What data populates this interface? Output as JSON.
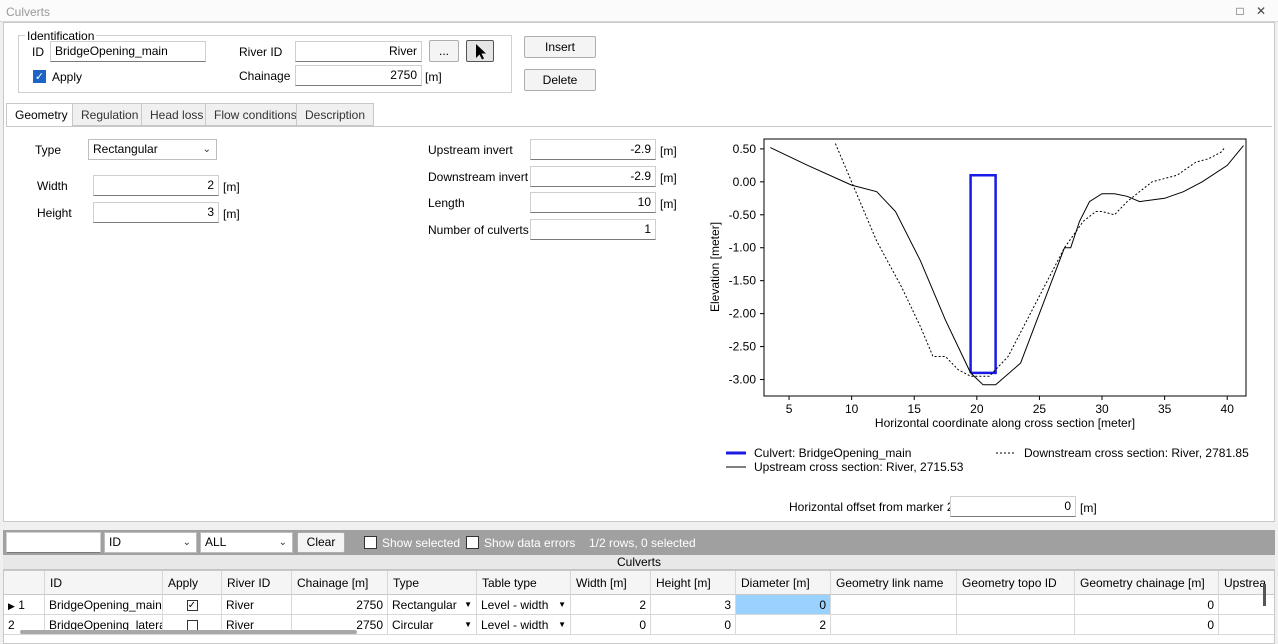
{
  "window": {
    "title": "Culverts"
  },
  "identification": {
    "legend": "Identification",
    "id_label": "ID",
    "id_value": "BridgeOpening_main",
    "apply_label": "Apply",
    "river_id_label": "River ID",
    "river_id_value": "River",
    "browse_label": "...",
    "chainage_label": "Chainage",
    "chainage_value": "2750",
    "unit_m": "[m]"
  },
  "actions": {
    "insert": "Insert",
    "delete": "Delete"
  },
  "tabs": [
    "Geometry",
    "Regulation",
    "Head loss",
    "Flow conditions",
    "Description"
  ],
  "geometry": {
    "type_label": "Type",
    "type_value": "Rectangular",
    "width_label": "Width",
    "width_value": "2",
    "height_label": "Height",
    "height_value": "3",
    "up_invert_label": "Upstream invert",
    "up_invert_value": "-2.9",
    "down_invert_label": "Downstream invert",
    "down_invert_value": "-2.9",
    "length_label": "Length",
    "length_value": "10",
    "num_label": "Number of culverts",
    "num_value": "1",
    "offset_label": "Horizontal offset from marker 2",
    "offset_value": "0",
    "unit": "[m]"
  },
  "chart_data": {
    "type": "line",
    "xlabel": "Horizontal coordinate along cross section [meter]",
    "ylabel": "Elevation [meter]",
    "xlim": [
      3,
      41.5
    ],
    "ylim": [
      -3.25,
      0.65
    ],
    "xticks": [
      5,
      10,
      15,
      20,
      25,
      30,
      35,
      40
    ],
    "yticks": [
      0.5,
      0.0,
      -0.5,
      -1.0,
      -1.5,
      -2.0,
      -2.5,
      -3.0
    ],
    "ytick_labels": [
      "0.50",
      "0.00",
      "-0.50",
      "-1.00",
      "-1.50",
      "-2.00",
      "-2.50",
      "-3.00"
    ],
    "legend": [
      {
        "name": "Culvert: BridgeOpening_main",
        "color": "#1a1ae6",
        "style": "solid-thick"
      },
      {
        "name": "Downstream cross section: River, 2781.85",
        "color": "#000000",
        "style": "dashed"
      },
      {
        "name": "Upstream cross section: River, 2715.53",
        "color": "#000000",
        "style": "solid"
      }
    ],
    "series": [
      {
        "name": "Culvert: BridgeOpening_main",
        "color": "#1a1ae6",
        "x": [
          19.5,
          21.5,
          21.5,
          19.5,
          19.5
        ],
        "y": [
          -2.9,
          -2.9,
          0.1,
          0.1,
          -2.9
        ]
      },
      {
        "name": "Upstream cross section: River, 2715.53",
        "color": "#000000",
        "dash": false,
        "x": [
          3.5,
          6.5,
          10,
          12,
          13.5,
          15.5,
          17.5,
          19.5,
          20.5,
          21.5,
          23.5,
          25,
          26,
          27,
          27.5,
          28.2,
          29,
          30,
          31,
          32,
          33,
          35,
          36.5,
          38,
          40,
          41.3
        ],
        "y": [
          0.52,
          0.25,
          -0.05,
          -0.15,
          -0.45,
          -1.2,
          -2.1,
          -2.9,
          -3.08,
          -3.08,
          -2.75,
          -2.0,
          -1.5,
          -1.0,
          -1.0,
          -0.6,
          -0.3,
          -0.18,
          -0.18,
          -0.22,
          -0.3,
          -0.25,
          -0.15,
          0.0,
          0.25,
          0.55
        ]
      },
      {
        "name": "Downstream cross section: River, 2781.85",
        "color": "#000000",
        "dash": true,
        "x": [
          8.7,
          10,
          12,
          14,
          15.5,
          16.5,
          17.5,
          18.5,
          19.5,
          21,
          22.5,
          24,
          25.5,
          27,
          28.5,
          29.5,
          30,
          31,
          32,
          34,
          36,
          37.5,
          38.5,
          39.5,
          39.8
        ],
        "y": [
          0.58,
          0.0,
          -0.9,
          -1.6,
          -2.2,
          -2.65,
          -2.65,
          -2.85,
          -2.95,
          -2.95,
          -2.65,
          -2.1,
          -1.55,
          -1.0,
          -0.6,
          -0.45,
          -0.45,
          -0.5,
          -0.3,
          0.0,
          0.1,
          0.3,
          0.35,
          0.45,
          0.52
        ]
      }
    ]
  },
  "filter": {
    "text_value": "",
    "column_value": "ID",
    "scope_value": "ALL",
    "clear_label": "Clear",
    "show_selected_label": "Show selected",
    "show_errors_label": "Show data errors",
    "status": "1/2 rows, 0 selected"
  },
  "grid": {
    "title": "Culverts",
    "columns": [
      "ID",
      "Apply",
      "River ID",
      "Chainage [m]",
      "Type",
      "Table type",
      "Width [m]",
      "Height [m]",
      "Diameter [m]",
      "Geometry link name",
      "Geometry topo ID",
      "Geometry chainage [m]",
      "Upstrea"
    ],
    "rows": [
      {
        "num": "1",
        "id": "BridgeOpening_main",
        "river": "River",
        "chainage": "2750",
        "type": "Rectangular",
        "table_type": "Level - width",
        "width": "2",
        "height": "3",
        "diameter": "0",
        "link": "",
        "topo": "",
        "geo_chainage": "0"
      },
      {
        "num": "2",
        "id": "BridgeOpening_lateral",
        "river": "River",
        "chainage": "2750",
        "type": "Circular",
        "table_type": "Level - width",
        "width": "0",
        "height": "0",
        "diameter": "2",
        "link": "",
        "topo": "",
        "geo_chainage": "0"
      }
    ]
  }
}
